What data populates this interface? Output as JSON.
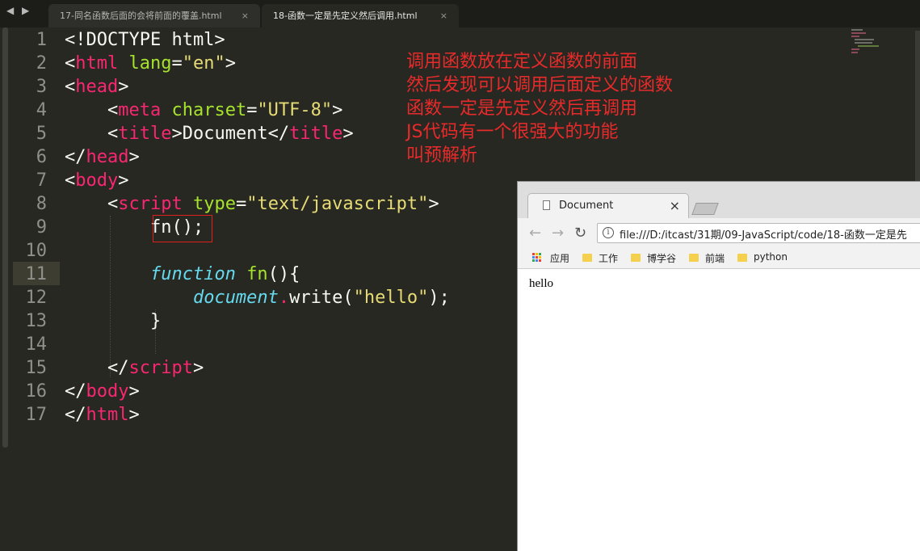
{
  "editor": {
    "tabs": [
      {
        "label": "17-同名函数后面的会将前面的覆盖.html",
        "close": "×"
      },
      {
        "label": "18-函数一定是先定义然后调用.html",
        "close": "×"
      }
    ],
    "nav_arrows": "◀ ▶",
    "line_numbers": [
      "1",
      "2",
      "3",
      "4",
      "5",
      "6",
      "7",
      "8",
      "9",
      "10",
      "11",
      "12",
      "13",
      "14",
      "15",
      "16",
      "17"
    ],
    "current_line": 11,
    "code": {
      "l1": "<!DOCTYPE html>",
      "l2_open": "<",
      "l2_tag": "html",
      "l2_attr": "lang",
      "l2_eq": "=",
      "l2_val": "\"en\"",
      "l2_close": ">",
      "l3_open": "<",
      "l3_tag": "head",
      "l3_close": ">",
      "l4_open": "<",
      "l4_tag": "meta",
      "l4_attr": "charset",
      "l4_eq": "=",
      "l4_val": "\"UTF-8\"",
      "l4_close": ">",
      "l5_open": "<",
      "l5_tag": "title",
      "l5_mid": ">Document</",
      "l5_tag2": "title",
      "l5_close": ">",
      "l6_open": "</",
      "l6_tag": "head",
      "l6_close": ">",
      "l7_open": "<",
      "l7_tag": "body",
      "l7_close": ">",
      "l8_open": "<",
      "l8_tag": "script",
      "l8_attr": "type",
      "l8_eq": "=",
      "l8_val": "\"text/javascript\"",
      "l8_close": ">",
      "l9": "fn();",
      "l11_kw": "function",
      "l11_name": "fn",
      "l11_rest": "(){",
      "l12_obj": "document",
      "l12_dot": ".",
      "l12_method": "write(",
      "l12_str": "\"hello\"",
      "l12_end": ");",
      "l13": "}",
      "l15_open": "</",
      "l15_tag": "script",
      "l15_close": ">",
      "l16_open": "</",
      "l16_tag": "body",
      "l16_close": ">",
      "l17_open": "</",
      "l17_tag": "html",
      "l17_close": ">"
    }
  },
  "annotation": {
    "lines": [
      "调用函数放在定义函数的前面",
      "然后发现可以调用后面定义的函数",
      "函数一定是先定义然后再调用",
      "JS代码有一个很强大的功能",
      "叫预解析"
    ],
    "color": "#e82a2a"
  },
  "browser": {
    "tab_title": "Document",
    "tab_close": "×",
    "back": "←",
    "forward": "→",
    "reload": "↻",
    "info": "i",
    "url": "file:///D:/itcast/31期/09-JavaScript/code/18-函数一定是先",
    "bookmarks": [
      "应用",
      "工作",
      "博学谷",
      "前端",
      "python"
    ],
    "content": "hello"
  },
  "colors": {
    "editor_bg": "#272822",
    "tag": "#f92672",
    "attr": "#a6e22e",
    "string": "#e6db74",
    "keyword": "#66d9ef",
    "highlight_box": "#e0201a"
  }
}
